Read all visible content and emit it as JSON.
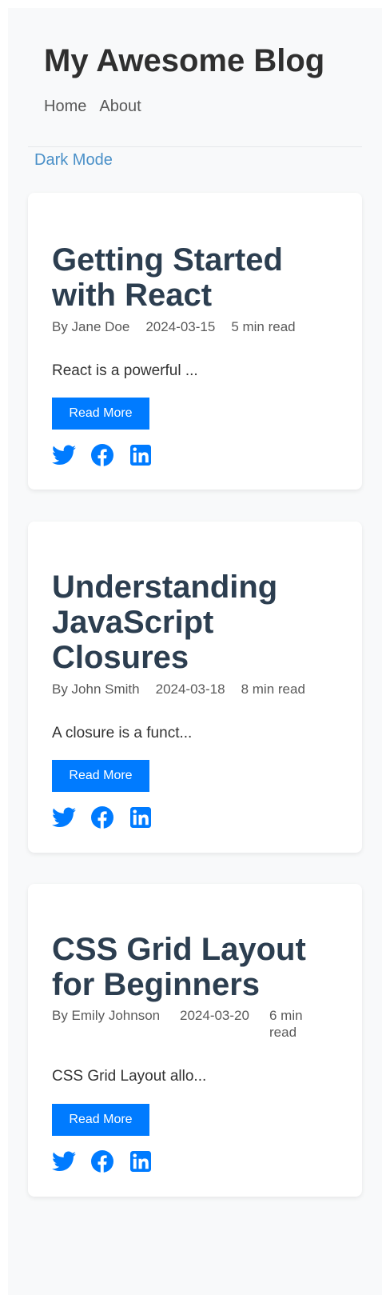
{
  "site": {
    "title": "My Awesome Blog",
    "nav": [
      {
        "label": "Home"
      },
      {
        "label": "About"
      }
    ],
    "dark_mode_label": "Dark Mode"
  },
  "posts": [
    {
      "title": "Getting Started with React",
      "author": "By Jane Doe",
      "date": "2024-03-15",
      "read_time": "5 min read",
      "excerpt": "React is a powerful ...",
      "button_label": "Read More"
    },
    {
      "title": "Understanding JavaScript Closures",
      "author": "By John Smith",
      "date": "2024-03-18",
      "read_time": "8 min read",
      "excerpt": "A closure is a funct...",
      "button_label": "Read More"
    },
    {
      "title": "CSS Grid Layout for Beginners",
      "author": "By Emily Johnson",
      "date": "2024-03-20",
      "read_time": "6 min read",
      "excerpt": "CSS Grid Layout allo...",
      "button_label": "Read More"
    }
  ],
  "share_icons": [
    "twitter-icon",
    "facebook-icon",
    "linkedin-icon"
  ],
  "colors": {
    "accent": "#007bff",
    "link": "#4a90c8",
    "title": "#2c3e50",
    "background": "#f8f9fa"
  }
}
